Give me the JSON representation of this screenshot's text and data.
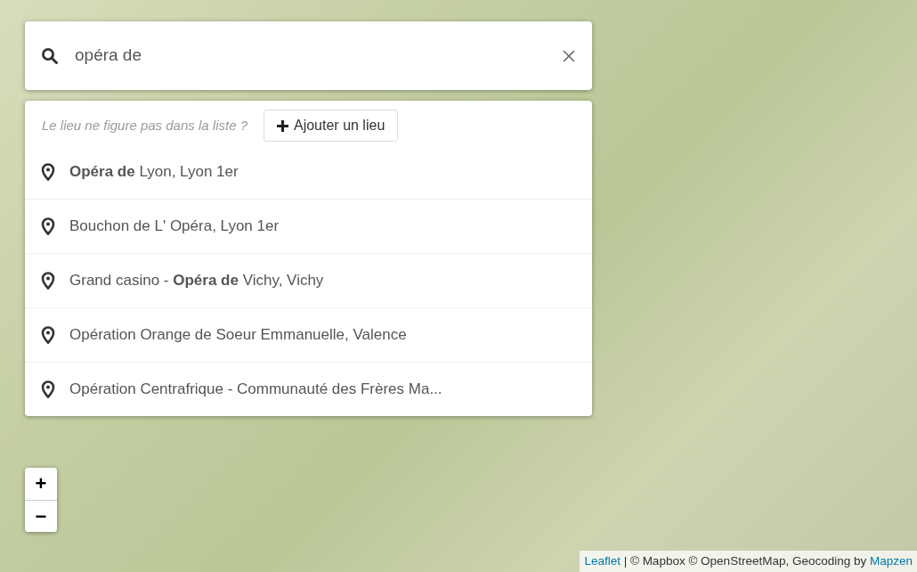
{
  "search": {
    "value": "opéra de"
  },
  "dropdown": {
    "hint": "Le lieu ne figure pas dans la liste ?",
    "add_button": "Ajouter un lieu",
    "results": [
      {
        "text": "**Opéra de** Lyon, Lyon 1er"
      },
      {
        "text": "Bouchon de L' Opéra, Lyon 1er"
      },
      {
        "text": "Grand casino - **Opéra de** Vichy, Vichy"
      },
      {
        "text": "Opération Orange de Soeur Emmanuelle, Valence"
      },
      {
        "text": "Opération Centrafrique - Communauté des Frères Ma..."
      }
    ]
  },
  "zoom_controls": [
    "+",
    "−"
  ],
  "attribution": [
    {
      "kind": "link",
      "text": "Leaflet"
    },
    {
      "kind": "text",
      "text": " | © Mapbox © OpenStreetMap, Geocoding by "
    },
    {
      "kind": "link",
      "text": "Mapzen"
    }
  ]
}
